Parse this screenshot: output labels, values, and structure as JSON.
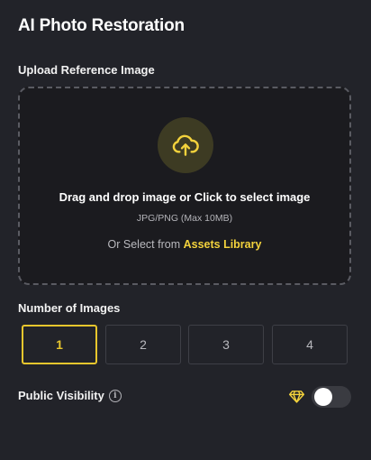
{
  "header": {
    "title": "AI Photo Restoration"
  },
  "upload": {
    "section_label": "Upload Reference Image",
    "primary_text": "Drag and drop image or Click to select image",
    "format_hint": "JPG/PNG (Max 10MB)",
    "alt_prefix": "Or Select from",
    "assets_link": "Assets Library",
    "icon": "cloud-upload-icon"
  },
  "image_count": {
    "section_label": "Number of Images",
    "options": [
      "1",
      "2",
      "3",
      "4"
    ],
    "selected": "1"
  },
  "visibility": {
    "label": "Public Visibility",
    "info_icon": "info-icon",
    "premium_icon": "diamond-icon",
    "enabled": false
  },
  "colors": {
    "background": "#222329",
    "accent": "#e8c62d",
    "drop_zone": "#1b1b1f"
  }
}
